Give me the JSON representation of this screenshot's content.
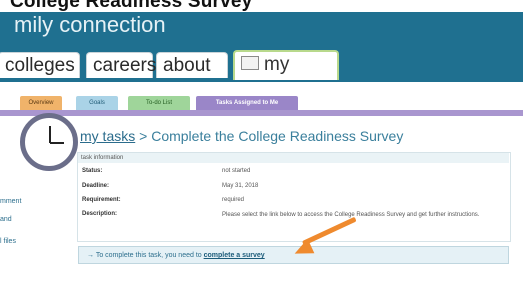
{
  "doc_title": "College Readiness Survey",
  "brand": "mily connection",
  "main_tabs": [
    {
      "label": "colleges"
    },
    {
      "label": "careers"
    },
    {
      "label": "about me"
    },
    {
      "label": "my planner",
      "active": true
    }
  ],
  "sub_tabs": [
    {
      "label": "Overview",
      "color": "#f0b36a"
    },
    {
      "label": "Goals",
      "color": "#aad3e7"
    },
    {
      "label": "To-do List",
      "color": "#9fd59a"
    },
    {
      "label": "Tasks Assigned to Me",
      "color": "#9a86c8",
      "active": true
    }
  ],
  "sidebar": {
    "items": [
      "mment",
      "and",
      "l files"
    ]
  },
  "heading": {
    "link": "my tasks",
    "separator": " > ",
    "title": "Complete the College Readiness Survey"
  },
  "task_info": {
    "header": "task information",
    "rows": [
      {
        "label": "Status:",
        "value": "not started"
      },
      {
        "label": "Deadline:",
        "value": "May 31, 2018"
      },
      {
        "label": "Requirement:",
        "value": "required"
      },
      {
        "label": "Description:",
        "value": "Please select the link below to access the College Readiness Survey and get further instructions."
      }
    ]
  },
  "cta": {
    "prefix": "→  To complete this task, you need to",
    "link": "complete a survey"
  },
  "colors": {
    "brand_bar": "#1f7090",
    "accent_link": "#2b6c8c",
    "arrow": "#ef8a2e",
    "purple": "#a996cf"
  }
}
